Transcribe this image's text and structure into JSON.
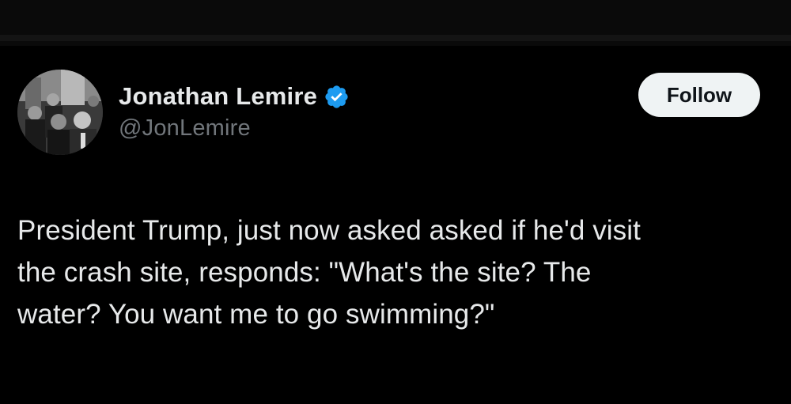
{
  "author": {
    "display_name": "Jonathan Lemire",
    "handle": "@JonLemire",
    "verified": true,
    "avatar_icon": "profile-photo"
  },
  "actions": {
    "follow_label": "Follow"
  },
  "tweet": {
    "text": "President Trump, just now asked asked if he'd visit\nthe crash site, responds: \"What's the site? The\nwater? You want me to go swimming?\""
  },
  "colors": {
    "background": "#000000",
    "text_primary": "#e7e9ea",
    "text_secondary": "#71767b",
    "verified_badge": "#1d9bf0",
    "follow_button_bg": "#eff3f4",
    "follow_button_text": "#0f1419"
  }
}
